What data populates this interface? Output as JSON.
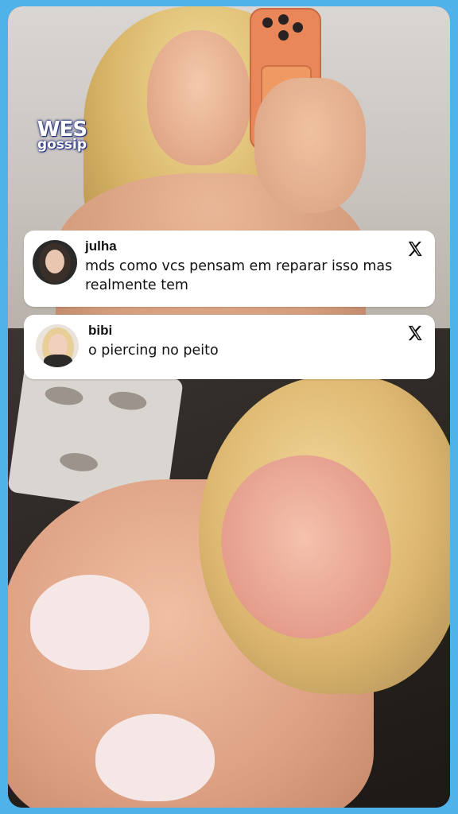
{
  "watermark": {
    "line1": "WES",
    "line2": "gossip"
  },
  "comments": [
    {
      "username": "julha",
      "text": "mds como vcs pensam em reparar isso mas realmente tem",
      "platform_icon": "x-logo-icon"
    },
    {
      "username": "bibi",
      "text": "o piercing no peito",
      "platform_icon": "x-logo-icon"
    }
  ],
  "colors": {
    "border": "#4fb3ea",
    "card_bg": "#ffffff",
    "text": "#111111",
    "watermark_outline": "#23307c"
  }
}
